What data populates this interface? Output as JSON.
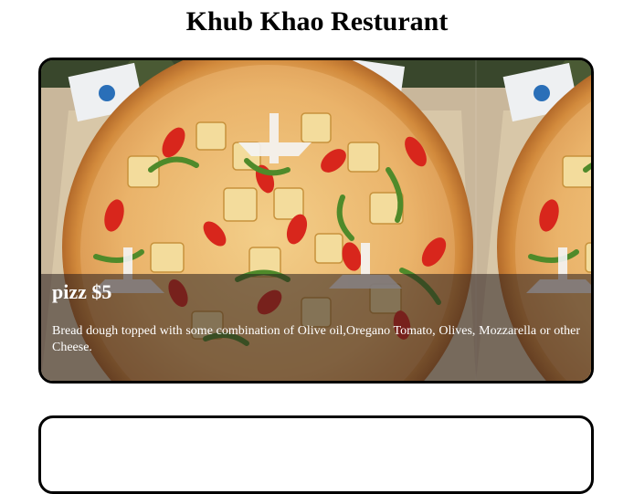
{
  "header": {
    "title": "Khub Khao Resturant"
  },
  "menu": {
    "items": [
      {
        "title": "pizz $5",
        "description": "Bread dough topped with some combination of Olive oil,Oregano Tomato, Olives, Mozzarella or other Cheese.",
        "image": "pizza-photo"
      }
    ]
  }
}
